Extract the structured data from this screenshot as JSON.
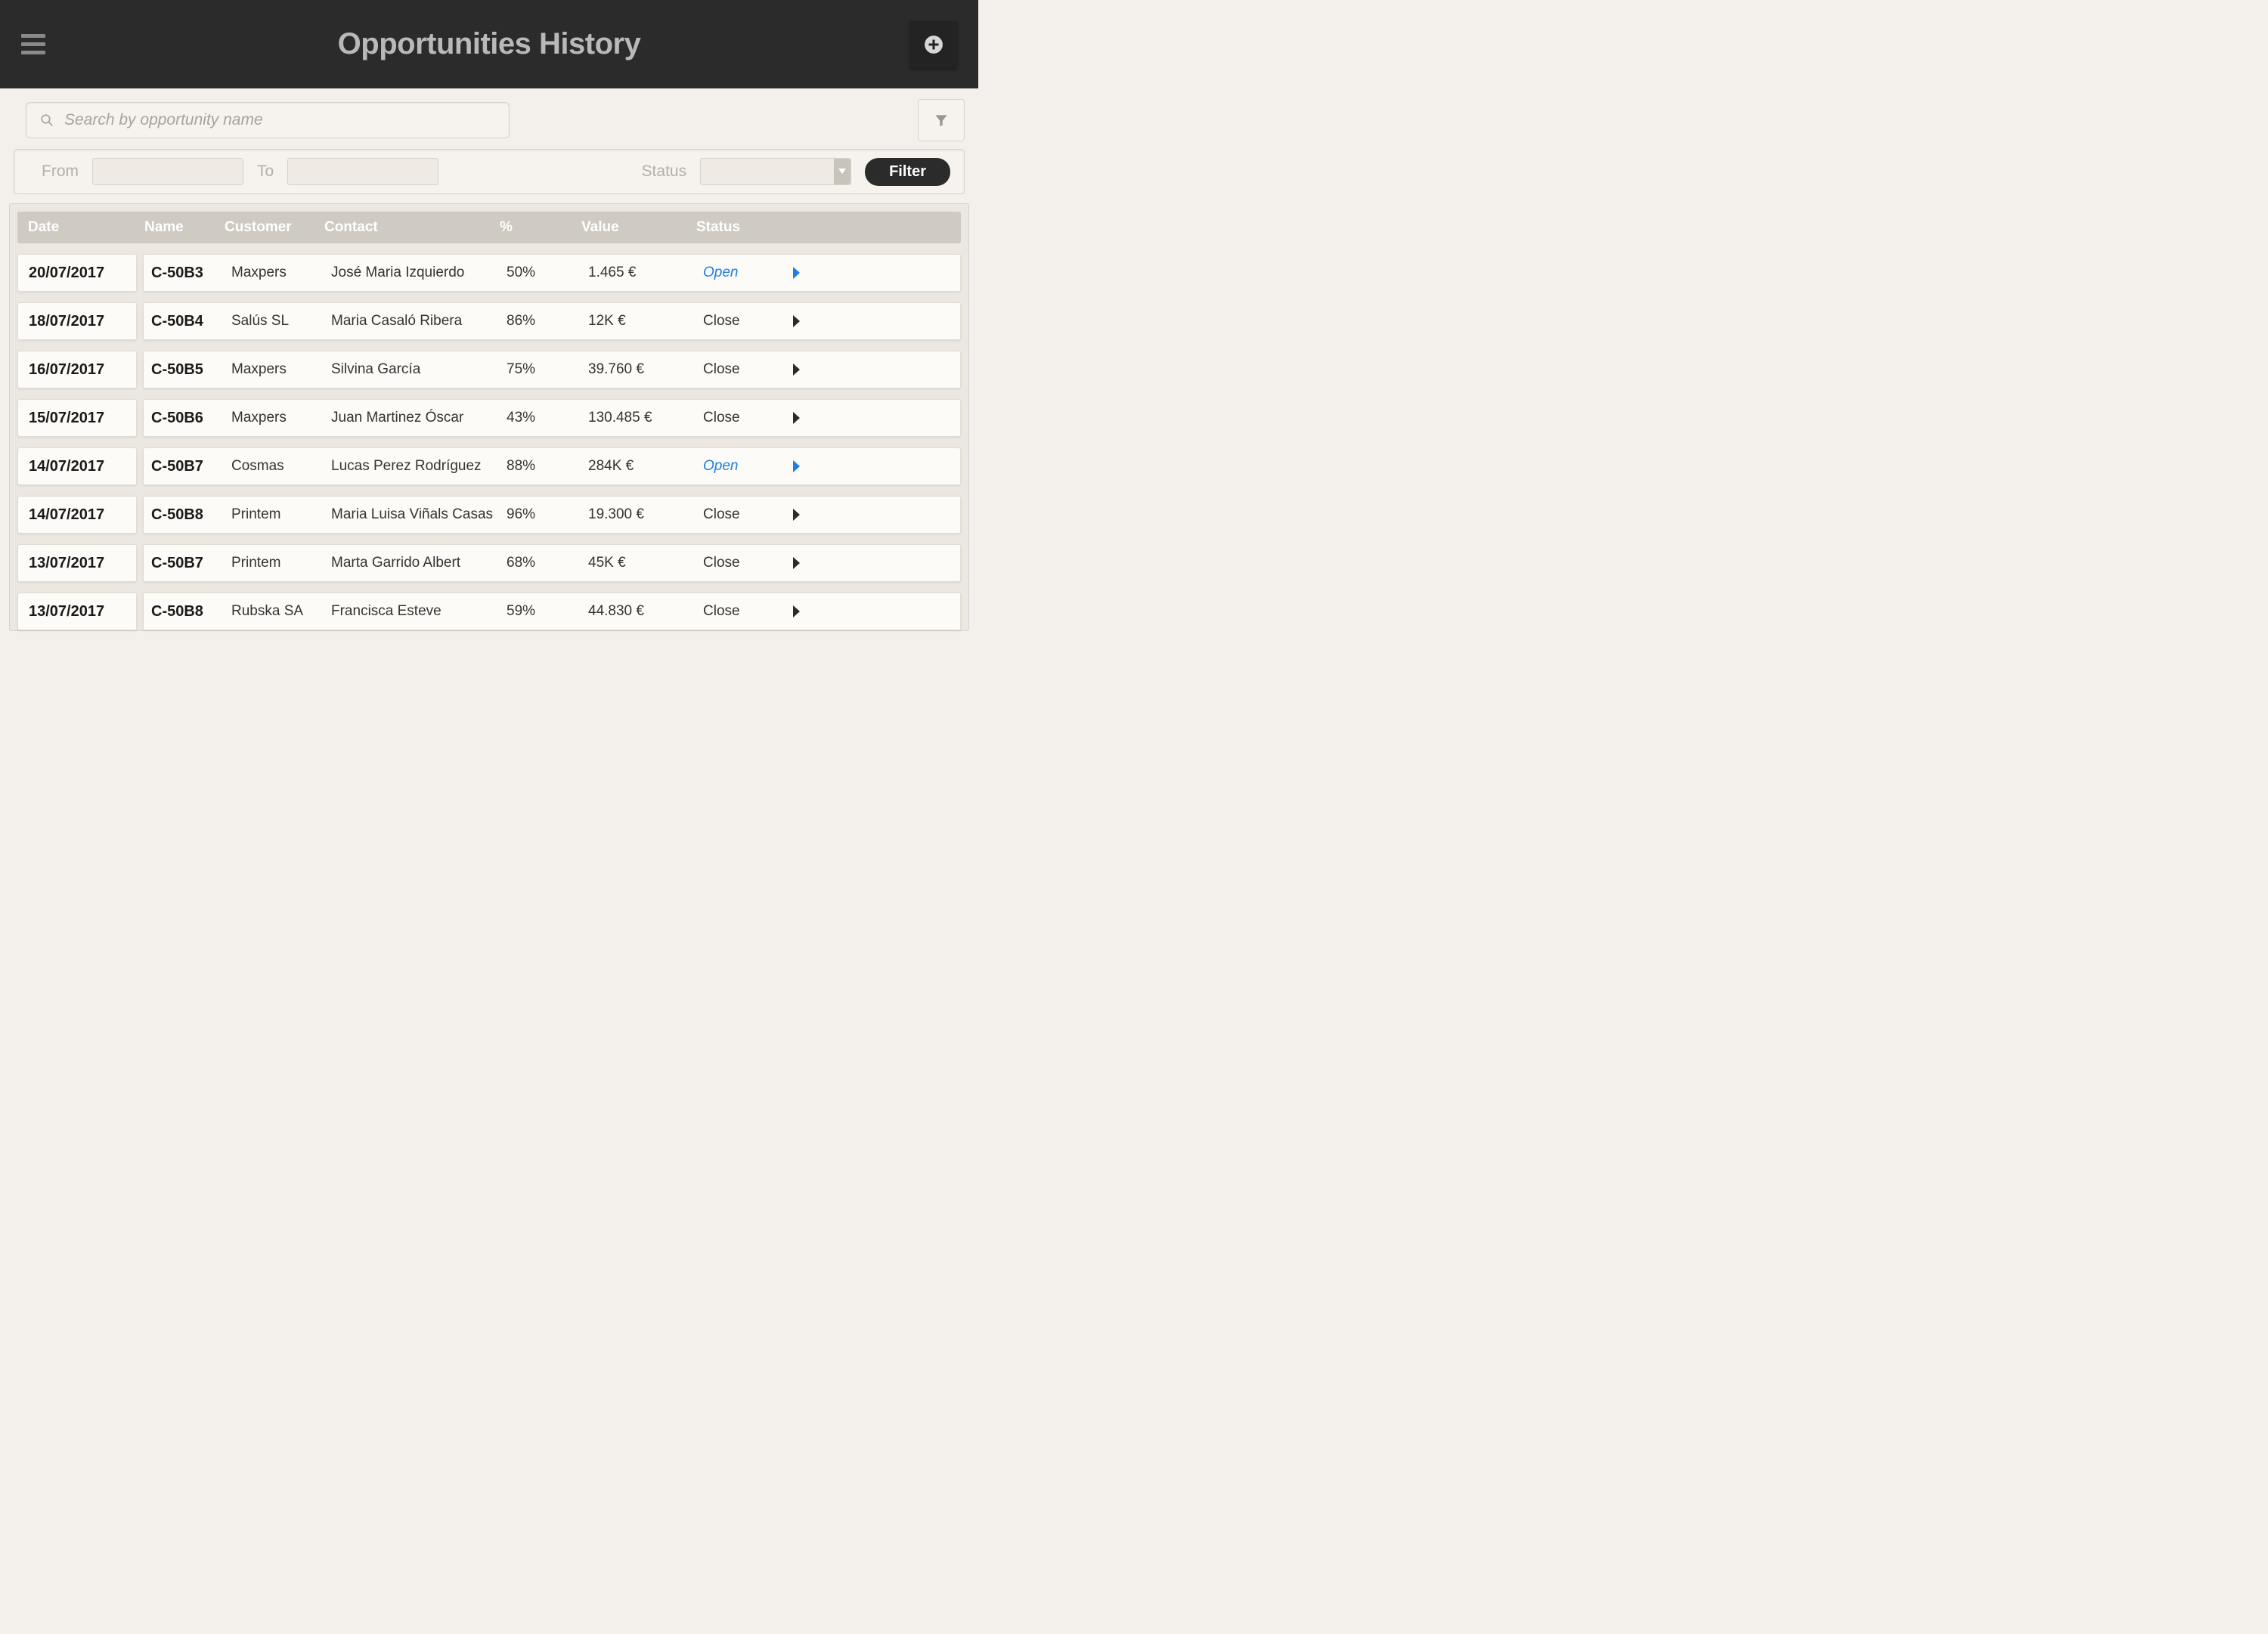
{
  "header": {
    "title": "Opportunities History"
  },
  "search": {
    "placeholder": "Search by opportunity name"
  },
  "filter_panel": {
    "from_label": "From",
    "to_label": "To",
    "status_label": "Status",
    "button_label": "Filter"
  },
  "table": {
    "headers": {
      "date": "Date",
      "name": "Name",
      "customer": "Customer",
      "contact": "Contact",
      "pct": "%",
      "value": "Value",
      "status": "Status"
    },
    "rows": [
      {
        "date": "20/07/2017",
        "name": "C-50B3",
        "customer": "Maxpers",
        "contact": "José Maria Izquierdo",
        "pct": "50%",
        "value": "1.465 €",
        "status": "Open",
        "open": true
      },
      {
        "date": "18/07/2017",
        "name": "C-50B4",
        "customer": "Salús SL",
        "contact": "Maria Casaló Ribera",
        "pct": "86%",
        "value": "12K €",
        "status": "Close",
        "open": false
      },
      {
        "date": "16/07/2017",
        "name": "C-50B5",
        "customer": "Maxpers",
        "contact": "Silvina García",
        "pct": "75%",
        "value": "39.760 €",
        "status": "Close",
        "open": false
      },
      {
        "date": "15/07/2017",
        "name": "C-50B6",
        "customer": "Maxpers",
        "contact": "Juan Martinez Óscar",
        "pct": "43%",
        "value": "130.485 €",
        "status": "Close",
        "open": false
      },
      {
        "date": "14/07/2017",
        "name": "C-50B7",
        "customer": "Cosmas",
        "contact": "Lucas Perez Rodríguez",
        "pct": "88%",
        "value": "284K €",
        "status": "Open",
        "open": true
      },
      {
        "date": "14/07/2017",
        "name": "C-50B8",
        "customer": "Printem",
        "contact": "Maria Luisa Viñals Casas",
        "pct": "96%",
        "value": "19.300 €",
        "status": "Close",
        "open": false
      },
      {
        "date": "13/07/2017",
        "name": "C-50B7",
        "customer": "Printem",
        "contact": "Marta Garrido Albert",
        "pct": "68%",
        "value": "45K €",
        "status": "Close",
        "open": false
      },
      {
        "date": "13/07/2017",
        "name": "C-50B8",
        "customer": "Rubska SA",
        "contact": "Francisca Esteve",
        "pct": "59%",
        "value": "44.830 €",
        "status": "Close",
        "open": false
      }
    ]
  }
}
